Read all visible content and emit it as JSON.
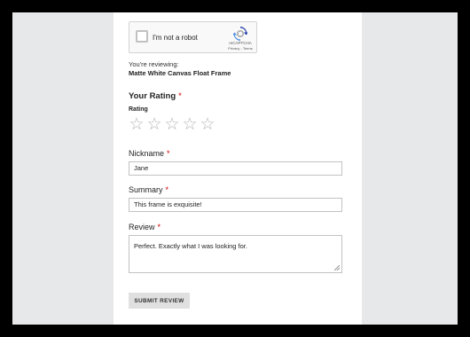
{
  "captcha": {
    "label": "I'm not a robot",
    "brand": "reCAPTCHA",
    "links": "Privacy - Terms"
  },
  "review": {
    "reviewing_label": "You're reviewing:",
    "product_name": "Matte White Canvas Float Frame"
  },
  "rating": {
    "heading": "Your Rating",
    "required_mark": "*",
    "sub_label": "Rating",
    "stars": [
      "☆",
      "☆",
      "☆",
      "☆",
      "☆"
    ],
    "value": 0
  },
  "nickname": {
    "label": "Nickname",
    "value": "Jane"
  },
  "summary": {
    "label": "Summary",
    "value": "This frame is exquisite!"
  },
  "review_body": {
    "label": "Review",
    "value": "Perfect. Exactly what I was looking for."
  },
  "submit": {
    "label": "SUBMIT REVIEW"
  },
  "colors": {
    "accent_required": "#cc0000",
    "star_empty": "#b5b5b5"
  }
}
